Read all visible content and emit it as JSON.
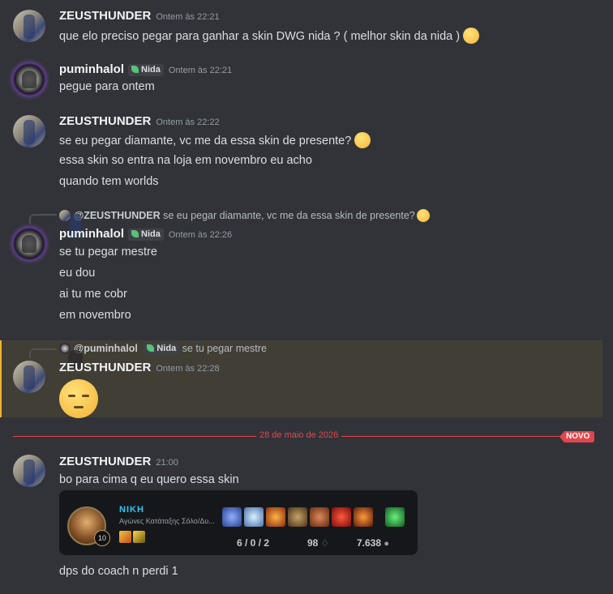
{
  "messages": [
    {
      "user": "ZEUSTHUNDER",
      "time": "Ontem às 22:21",
      "lines": [
        "que elo preciso pegar para ganhar a skin DWG nida ? ( melhor skin da nida )"
      ]
    },
    {
      "user": "puminhalol",
      "tag": "Nida",
      "time": "Ontem às 22:21",
      "lines": [
        "pegue para ontem"
      ]
    },
    {
      "user": "ZEUSTHUNDER",
      "time": "Ontem às 22:22",
      "lines": [
        "se eu pegar diamante, vc me da essa skin de presente?",
        "essa skin so entra na loja em novembro eu acho",
        "quando tem worlds"
      ]
    },
    {
      "reply_to": "@ZEUSTHUNDER",
      "reply_text": "se eu pegar diamante, vc me da essa skin de presente?",
      "user": "puminhalol",
      "tag": "Nida",
      "time": "Ontem às 22:26",
      "lines": [
        "se tu pegar mestre",
        "eu dou",
        "ai tu me cobr",
        "em novembro"
      ]
    },
    {
      "reply_to": "@puminhalol",
      "reply_tag": "Nida",
      "reply_text": "se tu pegar mestre",
      "user": "ZEUSTHUNDER",
      "time": "Ontem às 22:28",
      "emoji": "pensive-face-emoji"
    },
    {
      "user": "ZEUSTHUNDER",
      "time": "21:00",
      "lines": [
        "bo para cima q eu quero essa skin",
        "dps do coach n perdi 1"
      ]
    }
  ],
  "divider": {
    "date": "28 de maio de 2026",
    "badge": "NOVO"
  },
  "match_card": {
    "champion": "NIKH",
    "queue": "Αγώνες Κατάταξης Σόλο/Δυ...",
    "level": "10",
    "kda": "6 / 0 / 2",
    "cs": "98",
    "gold": "7.638"
  },
  "colors": {
    "background": "#323339",
    "accent": "#e2464c",
    "highlight_bar": "#f0b232",
    "champion_name": "#2fc6f2"
  }
}
